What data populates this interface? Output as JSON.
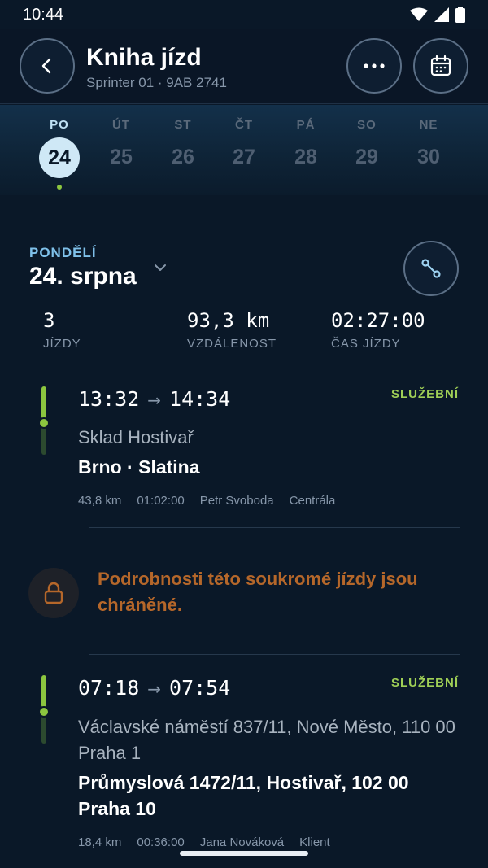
{
  "status_bar": {
    "time": "10:44"
  },
  "header": {
    "title": "Kniha jízd",
    "subtitle": "Sprinter 01 · 9AB 2741"
  },
  "week": [
    {
      "name": "PO",
      "num": "24",
      "selected": true,
      "has_trips": true
    },
    {
      "name": "ÚT",
      "num": "25"
    },
    {
      "name": "ST",
      "num": "26"
    },
    {
      "name": "ČT",
      "num": "27"
    },
    {
      "name": "PÁ",
      "num": "28"
    },
    {
      "name": "SO",
      "num": "29"
    },
    {
      "name": "NE",
      "num": "30"
    }
  ],
  "day_header": {
    "weekday": "PONDĚLÍ",
    "date": "24. srpna"
  },
  "stats": [
    {
      "value": "3",
      "label": "JÍZDY"
    },
    {
      "value": "93,3 km",
      "label": "VZDÁLENOST"
    },
    {
      "value": "02:27:00",
      "label": "ČAS JÍZDY"
    }
  ],
  "trips": [
    {
      "start": "13:32",
      "arrow": "→",
      "end": "14:34",
      "type": "SLUŽEBNÍ",
      "from": "Sklad Hostivař",
      "to": "Brno · Slatina",
      "distance": "43,8 km",
      "duration": "01:02:00",
      "driver": "Petr Svoboda",
      "purpose": "Centrála"
    },
    {
      "start": "07:18",
      "arrow": "→",
      "end": "07:54",
      "type": "SLUŽEBNÍ",
      "from": "Václavské náměstí 837/11, Nové Město, 110 00 Praha 1",
      "to": "Průmyslová 1472/11, Hostivař, 102 00 Praha 10",
      "distance": "18,4 km",
      "duration": "00:36:00",
      "driver": "Jana Nováková",
      "purpose": "Klient"
    }
  ],
  "private_notice": "Podrobnosti této soukromé jízdy jsou chráněné.",
  "colors": {
    "background": "#0a1828",
    "accent_blue": "#7fc1ea",
    "business_green": "#9fcf56",
    "private_orange": "#b5672a"
  },
  "icons": {
    "back": "chevron-left-icon",
    "more": "more-horizontal-icon",
    "calendar": "calendar-icon",
    "route": "route-icon",
    "dropdown": "chevron-down-icon",
    "lock": "lock-icon"
  }
}
